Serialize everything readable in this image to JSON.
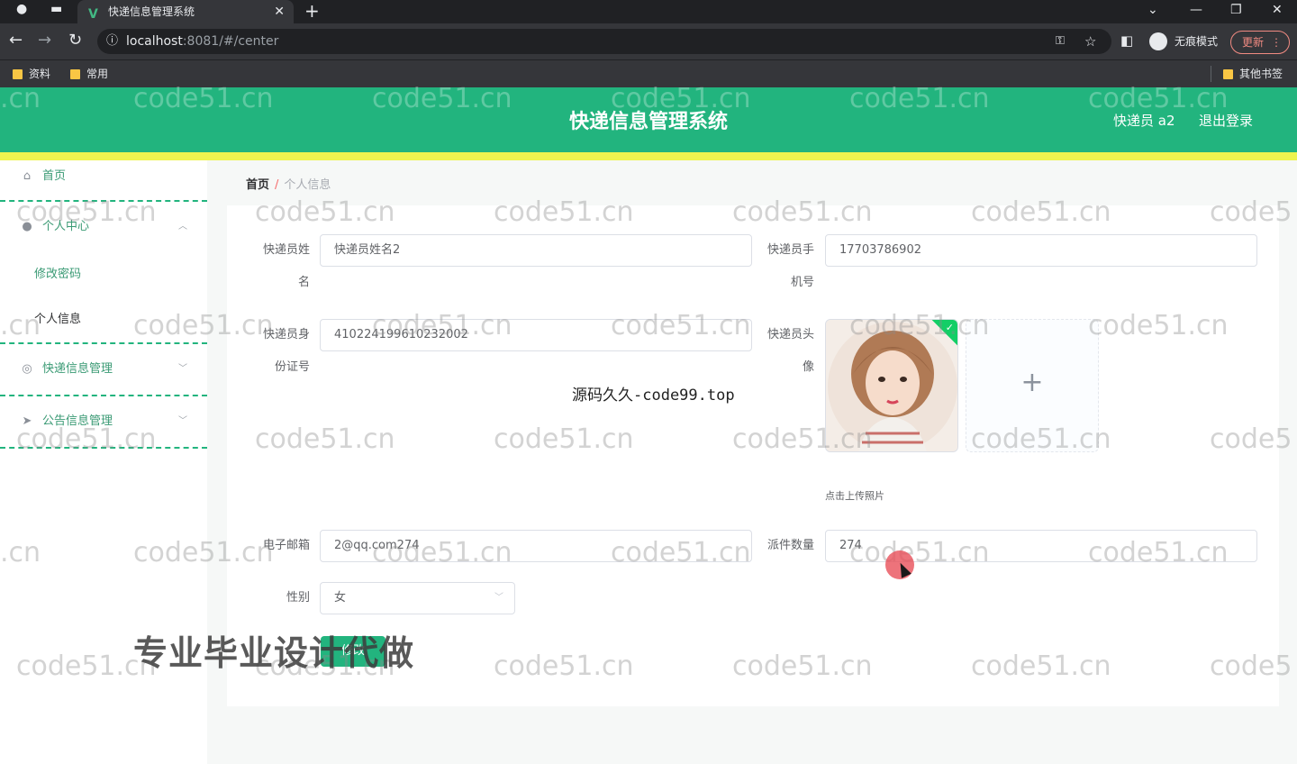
{
  "browser": {
    "tab_title": "快递信息管理系统",
    "url_host": "localhost",
    "url_rest": ":8081/#/center",
    "profile_label": "无痕模式",
    "update_label": "更新",
    "bookmarks": [
      "资料",
      "常用"
    ],
    "other_bookmarks": "其他书签"
  },
  "header": {
    "title": "快递信息管理系统",
    "user": "快递员 a2",
    "logout": "退出登录"
  },
  "sidebar": {
    "home": "首页",
    "personal_center": "个人中心",
    "change_password": "修改密码",
    "personal_info": "个人信息",
    "express_mgmt": "快递信息管理",
    "notice_mgmt": "公告信息管理"
  },
  "breadcrumb": {
    "home": "首页",
    "separator": "/",
    "current": "个人信息"
  },
  "form": {
    "name_label_1": "快递员姓",
    "name_label_2": "名",
    "name_value": "快递员姓名2",
    "phone_label_1": "快递员手",
    "phone_label_2": "机号",
    "phone_value": "17703786902",
    "id_label_1": "快递员身",
    "id_label_2": "份证号",
    "id_value": "410224199610232002",
    "avatar_label_1": "快递员头",
    "avatar_label_2": "像",
    "upload_tip": "点击上传照片",
    "email_label": "电子邮箱",
    "email_value": "2@qq.com274",
    "count_label": "派件数量",
    "count_value": "274",
    "gender_label": "性别",
    "gender_value": "女",
    "submit": "修改"
  },
  "overlays": {
    "watermark": "code51.cn",
    "watermark_left": ".cn",
    "watermark_right": "code5",
    "source_note": "源码久久-code99.top",
    "ad_text": "专业毕业设计代做"
  },
  "colors": {
    "brand": "#22b47e",
    "strip": "#eef44f"
  }
}
